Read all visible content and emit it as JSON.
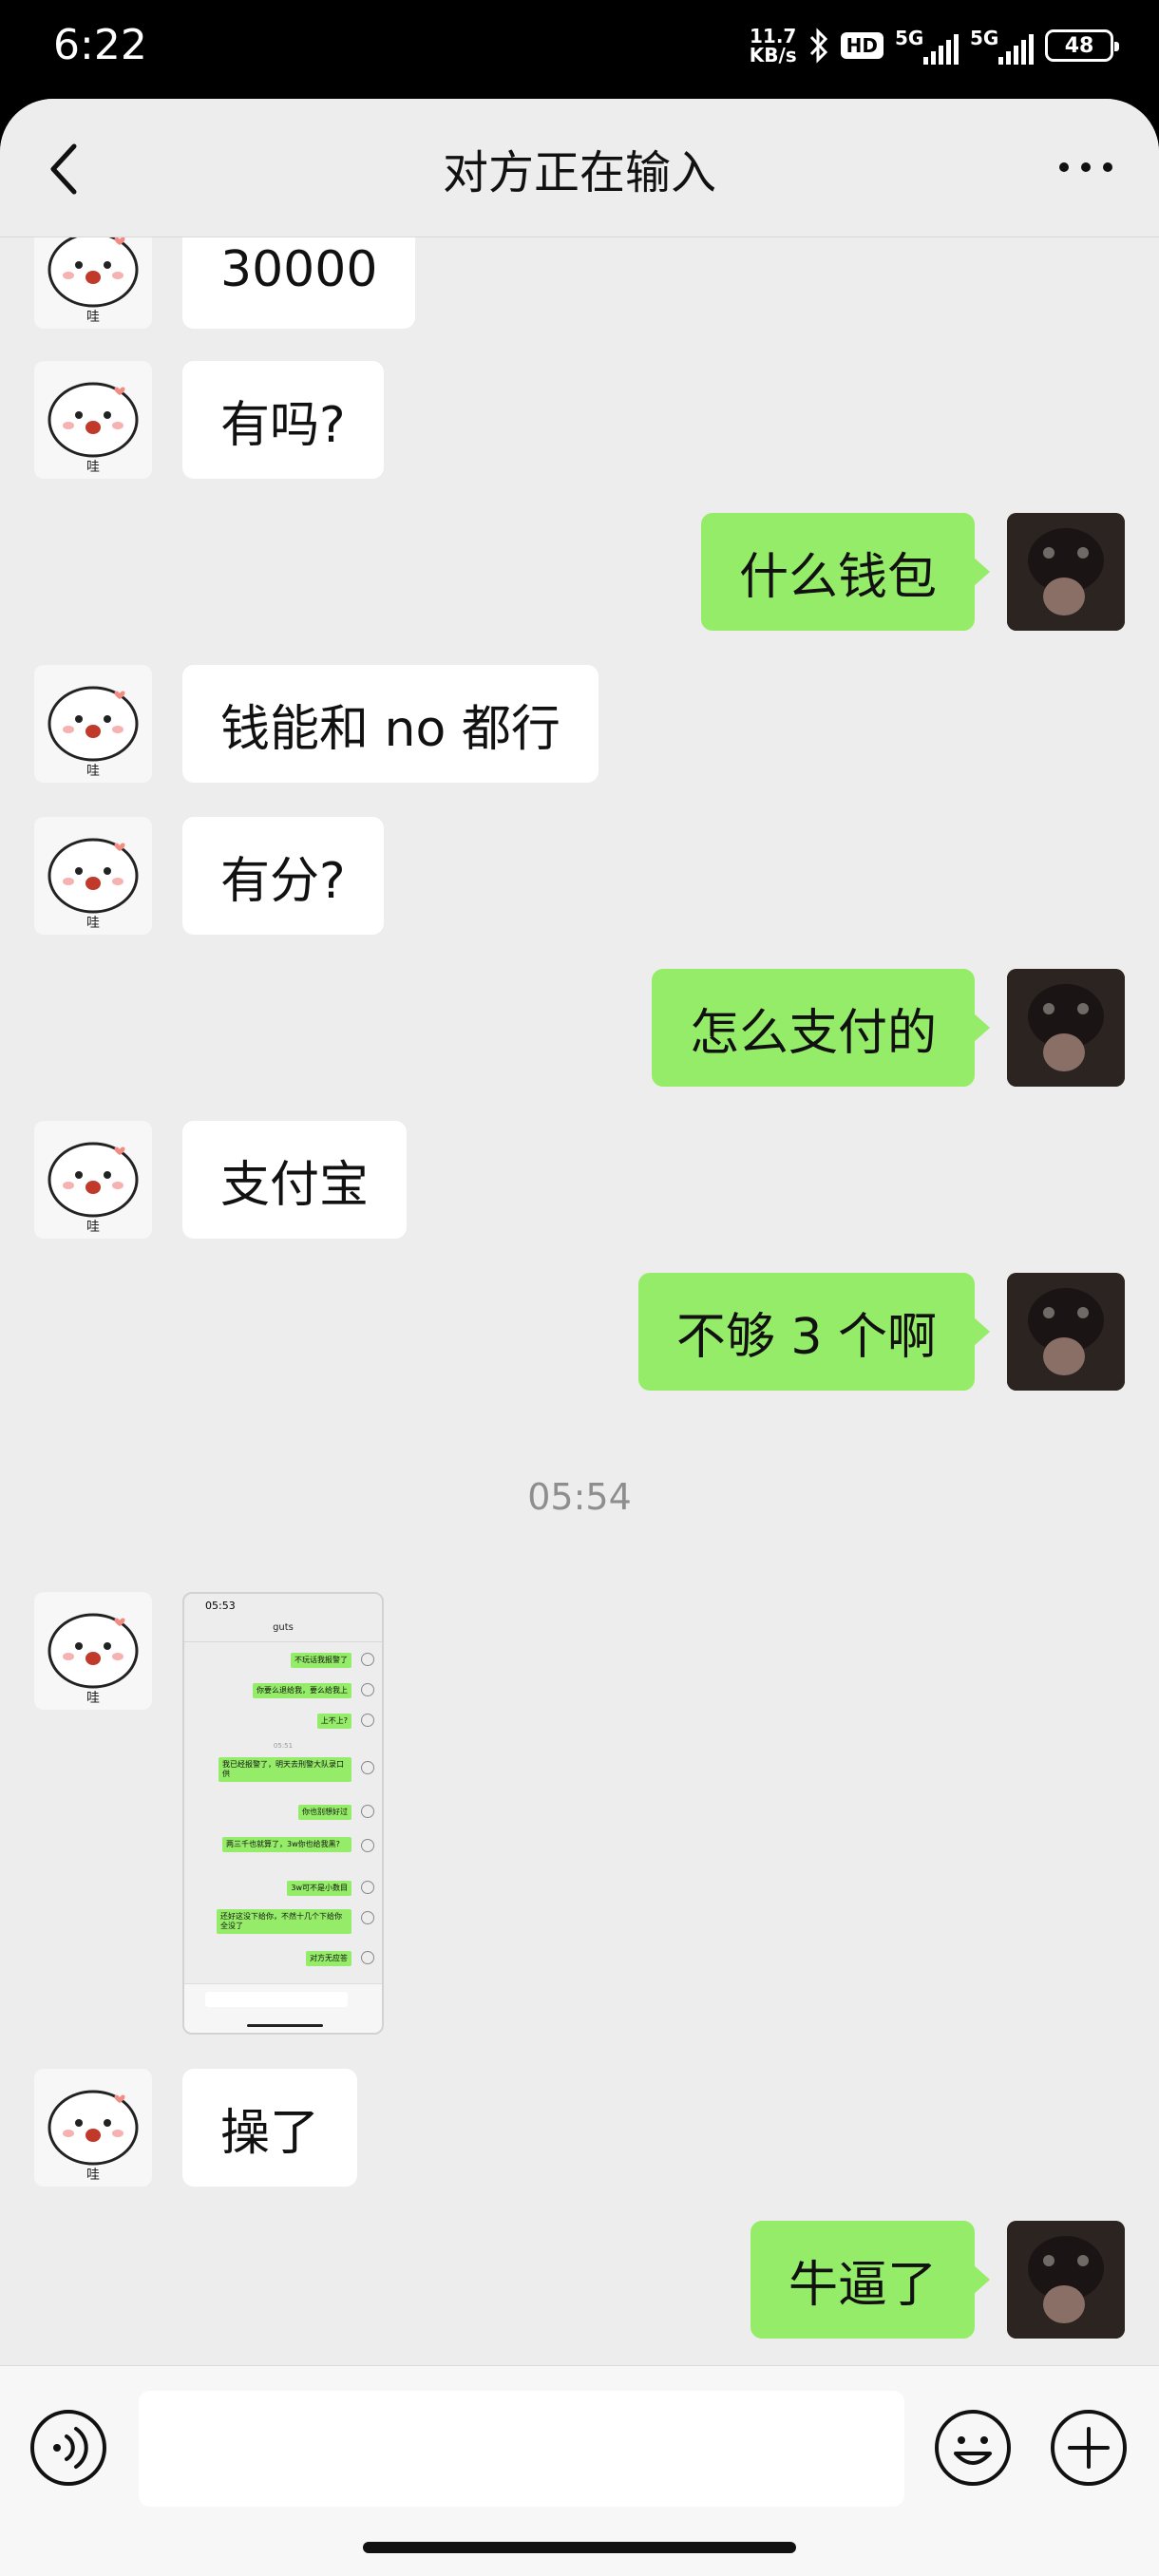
{
  "status_bar": {
    "time": "6:22",
    "net_speed_value": "11.7",
    "net_speed_unit": "KB/s",
    "hd_badge": "HD",
    "signal1_label": "5G",
    "signal2_label": "5G",
    "battery": "48"
  },
  "header": {
    "title": "对方正在输入"
  },
  "messages": [
    {
      "side": "left",
      "text": "30000"
    },
    {
      "side": "left",
      "text": "有吗?"
    },
    {
      "side": "right",
      "text": "什么钱包"
    },
    {
      "side": "left",
      "text": "钱能和 no 都行"
    },
    {
      "side": "left",
      "text": "有分?"
    },
    {
      "side": "right",
      "text": "怎么支付的"
    },
    {
      "side": "left",
      "text": "支付宝"
    },
    {
      "side": "right",
      "text": "不够 3 个啊"
    },
    {
      "side": "left",
      "text": "操了"
    },
    {
      "side": "right",
      "text": "牛逼了"
    }
  ],
  "timestamp": "05:54",
  "screenshot_image": {
    "time": "05:53",
    "title": "guts",
    "messages": [
      "不玩话我报警了",
      "你要么退给我，要么给我上",
      "上不上?",
      "我已经报警了，明天去刑警大队录口供",
      "你也别想好过",
      "两三千也就算了，3w你也给我黑?",
      "3w可不是小数目",
      "还好这没下给你，不然十几个下给你全没了",
      "对方无应答"
    ],
    "inner_timestamp": "05:51"
  },
  "avatar_left_caption": "哇",
  "colors": {
    "chat_bg": "#ededed",
    "bubble_sent": "#95ec69",
    "bubble_received": "#ffffff",
    "status_bar_bg": "#000000"
  },
  "icons": {
    "back": "chevron-left-icon",
    "more": "more-dots-icon",
    "voice": "voice-icon",
    "emoji": "emoji-icon",
    "plus": "plus-icon"
  },
  "input": {
    "value": ""
  }
}
